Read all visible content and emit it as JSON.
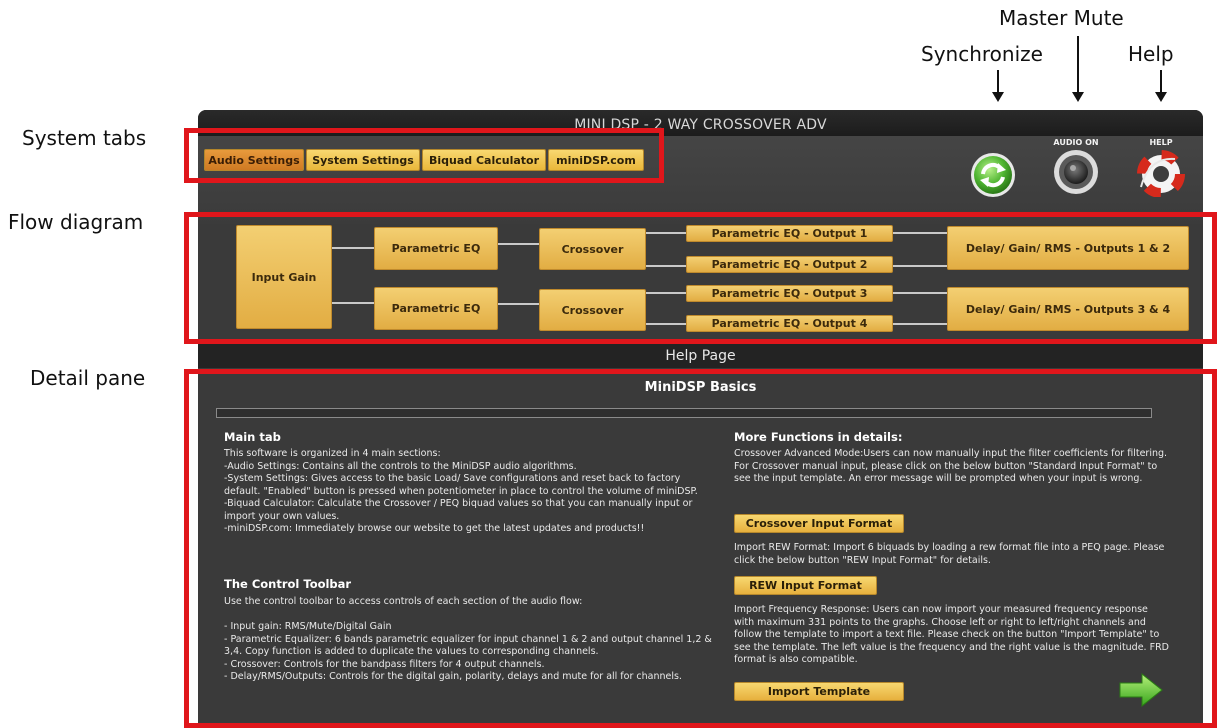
{
  "annotations": {
    "system_tabs": "System tabs",
    "flow_diagram": "Flow diagram",
    "detail_pane": "Detail pane",
    "synchronize": "Synchronize",
    "master_mute": "Master Mute",
    "help": "Help"
  },
  "window": {
    "title": "MINI DSP - 2 WAY CROSSOVER ADV"
  },
  "tabs": [
    {
      "label": "Audio Settings",
      "active": true
    },
    {
      "label": "System Settings",
      "active": false
    },
    {
      "label": "Biquad Calculator",
      "active": false
    },
    {
      "label": "miniDSP.com",
      "active": false
    }
  ],
  "top_icons": {
    "sync": {
      "icon": "sync-icon"
    },
    "audio": {
      "label": "AUDIO ON",
      "icon": "speaker-icon"
    },
    "help": {
      "label": "HELP",
      "icon": "lifebuoy-icon"
    }
  },
  "flow": {
    "input_gain": "Input Gain",
    "peq_1": "Parametric EQ",
    "peq_2": "Parametric EQ",
    "crossover_1": "Crossover",
    "crossover_2": "Crossover",
    "out_peq_1": "Parametric EQ - Output 1",
    "out_peq_2": "Parametric EQ - Output 2",
    "out_peq_3": "Parametric EQ - Output 3",
    "out_peq_4": "Parametric EQ - Output 4",
    "delay_12": "Delay/ Gain/ RMS - Outputs 1 & 2",
    "delay_34": "Delay/ Gain/ RMS - Outputs 3 & 4"
  },
  "help_bar": "Help Page",
  "detail": {
    "heading": "MiniDSP Basics",
    "main_tab_title": "Main tab",
    "main_tab_text": "This software is organized in 4 main sections:\n-Audio Settings: Contains all the controls to the MiniDSP audio algorithms.\n-System Settings: Gives access to the basic Load/ Save configurations and reset back to factory default. \"Enabled\" button is pressed  when potentiometer in place to control the volume of miniDSP.\n-Biquad Calculator: Calculate the Crossover / PEQ biquad values so that you can manually input or import your own values.\n-miniDSP.com: Immediately browse our website to get the latest updates and products!!",
    "toolbar_title": "The Control Toolbar",
    "toolbar_text": "Use the control toolbar to access controls of each section of the audio flow:\n\n- Input gain: RMS/Mute/Digital Gain\n- Parametric Equalizer: 6 bands parametric equalizer for input channel 1 & 2 and output channel 1,2 & 3,4. Copy function is added to duplicate the values to corresponding channels.\n- Crossover: Controls for the bandpass filters for 4 output channels.\n- Delay/RMS/Outputs: Controls for the digital gain, polarity, delays and mute for all for channels.",
    "more_title": "More Functions in details:",
    "crossover_text": "Crossover Advanced Mode:Users can now manually input the filter coefficients for filtering. For Crossover manual input, please click on the below button \"Standard Input Format\" to see the input template. An error message will be prompted when your input is wrong.",
    "crossover_button": "Crossover Input Format",
    "rew_text": "Import REW Format: Import 6 biquads by loading a rew format file into a PEQ page. Please click the below button \"REW Input Format\" for details.",
    "rew_button": "REW Input Format",
    "frd_text": "Import Frequency Response: Users can now import your measured frequency response with maximum 331 points to the graphs. Choose left or right to left/right channels and follow the template to import a text file. Please check on the button \"Import Template\"  to see the template.  The left value is the frequency and the right value is the magnitude. FRD format is also compatible.",
    "import_button": "Import Template",
    "next_icon": "arrow-right-icon"
  },
  "colors": {
    "highlight": "#e0161b",
    "block": "#e8b84e",
    "window_bg": "#3a3a3a"
  }
}
